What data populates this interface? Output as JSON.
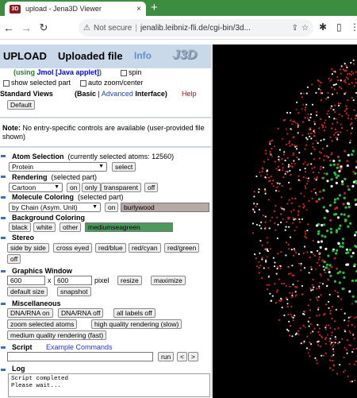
{
  "browser": {
    "tab_title": "upload - Jena3D Viewer",
    "favicon_text": "3D",
    "tab_close": "×",
    "new_tab": "+",
    "not_secure": "Not secure",
    "url": "jenalib.leibniz-fli.de/cgi-bin/3d..."
  },
  "header": {
    "upload": "UPLOAD",
    "uploaded_file": "Uploaded file",
    "info": "Info",
    "logo": "J3D"
  },
  "applet": {
    "prefix": "(using ",
    "link": "Jmol [Java applet]",
    "suffix": ")",
    "spin_label": "spin",
    "show_selected_label": "show selected part",
    "auto_zoom_label": "auto zoom/center"
  },
  "standard_views": {
    "label": "Standard Views",
    "basic": "(Basic",
    "pipe": " | ",
    "advanced": "Advanced",
    "interface": " Interface)",
    "help": "Help",
    "default_button": "Default"
  },
  "note": {
    "bold": "Note:",
    "text": " No entry-specific controls are available (user-provided file shown)"
  },
  "atom_selection": {
    "title": "Atom Selection",
    "sub": "(currently selected atoms: 12560)",
    "value": "Protein",
    "select_button": "select"
  },
  "rendering": {
    "title": "Rendering",
    "sub": "(selected part)",
    "value": "Cartoon",
    "on": "on",
    "only": "only",
    "transparent": "transparent",
    "off": "off"
  },
  "molecule_coloring": {
    "title": "Molecule Coloring",
    "sub": "(selected part)",
    "value": "by Chain (Asym. Unit)",
    "on": "on",
    "color_text": "burlywood"
  },
  "background_coloring": {
    "title": "Background Coloring",
    "black": "black",
    "white": "white",
    "other": "other",
    "color_text": "mediumseagreen"
  },
  "stereo": {
    "title": "Stereo",
    "buttons": [
      "side by side",
      "cross eyed",
      "red/blue",
      "red/cyan",
      "red/green",
      "off"
    ]
  },
  "graphics_window": {
    "title": "Graphics Window",
    "width": "600",
    "x": "x",
    "height": "600",
    "unit": "pixel",
    "resize": "resize",
    "maximize": "maximize",
    "default_size": "default size",
    "snapshot": "snapshot"
  },
  "misc": {
    "title": "Miscellaneous",
    "buttons": [
      "DNA/RNA on",
      "DNA/RNA off",
      "all labels off",
      "zoom selected atoms",
      "high quality rendering (slow)",
      "medium quality rendering (fast)"
    ]
  },
  "script": {
    "title": "Script",
    "examples": "Example Commands",
    "run": "run",
    "prev": "<",
    "next": ">"
  },
  "log": {
    "title": "Log",
    "lines": [
      "Script completed",
      "Please wait..."
    ]
  },
  "colors": {
    "header_bg": "#cad9ea",
    "burlywood_swatch": "#b6a8a5",
    "mediumseagreen_swatch": "#4c9a5b",
    "viewer_bg": "#000000"
  }
}
